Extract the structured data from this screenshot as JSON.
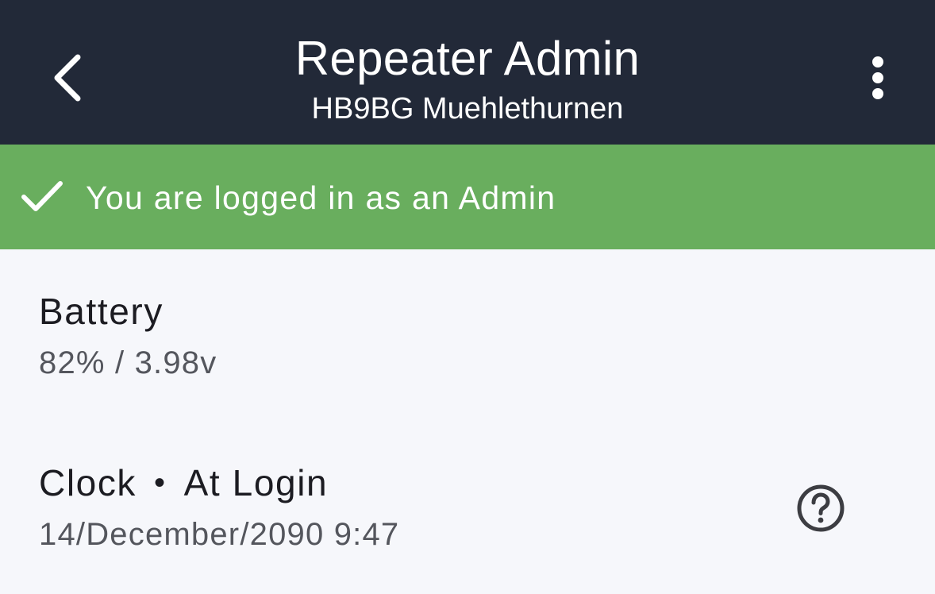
{
  "header": {
    "title": "Repeater Admin",
    "subtitle": "HB9BG Muehlethurnen",
    "back_icon": "chevron-left-icon",
    "menu_icon": "more-vertical-icon"
  },
  "banner": {
    "text": "You are logged in as an Admin",
    "icon": "check-icon",
    "color": "#69ae5e"
  },
  "items": {
    "battery": {
      "title": "Battery",
      "value": "82% / 3.98v"
    },
    "clock": {
      "title": "Clock",
      "separator": "•",
      "qualifier": "At Login",
      "value": "14/December/2090 9:47",
      "help_icon": "help-circle-icon"
    }
  },
  "colors": {
    "header_bg": "#222938",
    "banner_bg": "#69ae5e",
    "page_bg": "#f6f7fb"
  }
}
